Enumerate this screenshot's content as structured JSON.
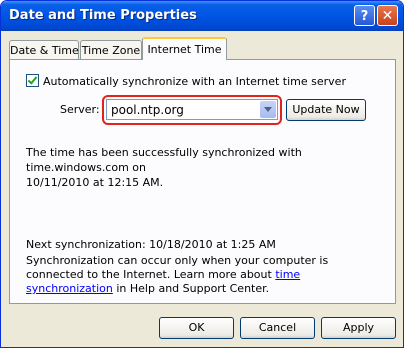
{
  "window": {
    "title": "Date and Time Properties",
    "help_label": "?",
    "close_label": "✕"
  },
  "tabs": [
    {
      "label": "Date & Time"
    },
    {
      "label": "Time Zone"
    },
    {
      "label": "Internet Time"
    }
  ],
  "sync": {
    "checkbox_checked": true,
    "checkbox_label": "Automatically synchronize with an Internet time server",
    "server_label": "Server:",
    "server_value": "pool.ntp.org",
    "update_button": "Update Now"
  },
  "status": {
    "line1": "The time has been successfully synchronized with time.windows.com on",
    "line2": "10/11/2010 at 12:15 AM.",
    "next_sync": "Next synchronization: 10/18/2010 at 1:25 AM",
    "note_part1": "Synchronization can occur only when your computer is connected to the Internet.  Learn more about ",
    "note_link": "time synchronization",
    "note_part2": " in Help and Support Center."
  },
  "buttons": {
    "ok": "OK",
    "cancel": "Cancel",
    "apply": "Apply"
  }
}
